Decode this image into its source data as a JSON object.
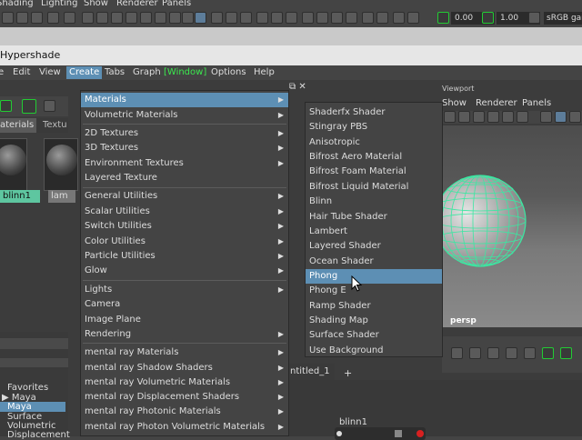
{
  "top_menu": [
    "Shading",
    "Lighting",
    "Show",
    "Renderer",
    "Panels"
  ],
  "top_toolbar": {
    "value1": "0.00",
    "value2": "1.00",
    "color_space": "sRGB gam"
  },
  "hypershade": {
    "title": "Hypershade",
    "menubar": [
      "e",
      "Edit",
      "View",
      "Create",
      "Tabs",
      "Graph",
      "[Window]",
      "Options",
      "Help"
    ],
    "tabs": [
      "aterials",
      "Textu"
    ],
    "swatches": [
      "blinn1",
      "lam"
    ],
    "browser": {
      "favorites": "Favorites",
      "maya_collapsed": "Maya",
      "maya_selected": "Maya",
      "surface": "Surface",
      "volumetric": "Volumetric",
      "displacement": "Displacement"
    },
    "node_tab": "ntitled_1",
    "node_tab_add": "+",
    "node_label": "blinn1"
  },
  "viewport": {
    "label": "Viewport",
    "menu": [
      "Show",
      "Renderer",
      "Panels"
    ],
    "camera": "persp"
  },
  "create_menu": {
    "groups": [
      [
        "Materials",
        "Volumetric Materials"
      ],
      [
        "2D Textures",
        "3D Textures",
        "Environment Textures",
        "Layered Texture"
      ],
      [
        "General Utilities",
        "Scalar Utilities",
        "Switch Utilities",
        "Color Utilities",
        "Particle Utilities",
        "Glow"
      ],
      [
        "Lights",
        "Camera",
        "Image Plane",
        "Rendering"
      ],
      [
        "mental ray Materials",
        "mental ray Shadow Shaders",
        "mental ray Volumetric Materials",
        "mental ray Displacement Shaders",
        "mental ray Photonic Materials",
        "mental ray Photon Volumetric Materials"
      ]
    ],
    "highlighted": "Materials"
  },
  "materials_submenu": {
    "items": [
      "Shaderfx Shader",
      "Stingray PBS",
      "Anisotropic",
      "Bifrost Aero Material",
      "Bifrost Foam Material",
      "Bifrost Liquid Material",
      "Blinn",
      "Hair Tube Shader",
      "Lambert",
      "Layered Shader",
      "Ocean Shader",
      "Phong",
      "Phong E",
      "Ramp Shader",
      "Shading Map",
      "Surface Shader",
      "Use Background"
    ],
    "highlighted": "Phong"
  },
  "colors": {
    "highlight": "#5d8fb4",
    "accent_green": "#3be84e",
    "selected_swatch": "#5ec6a0",
    "wireframe": "#3be8a2"
  }
}
